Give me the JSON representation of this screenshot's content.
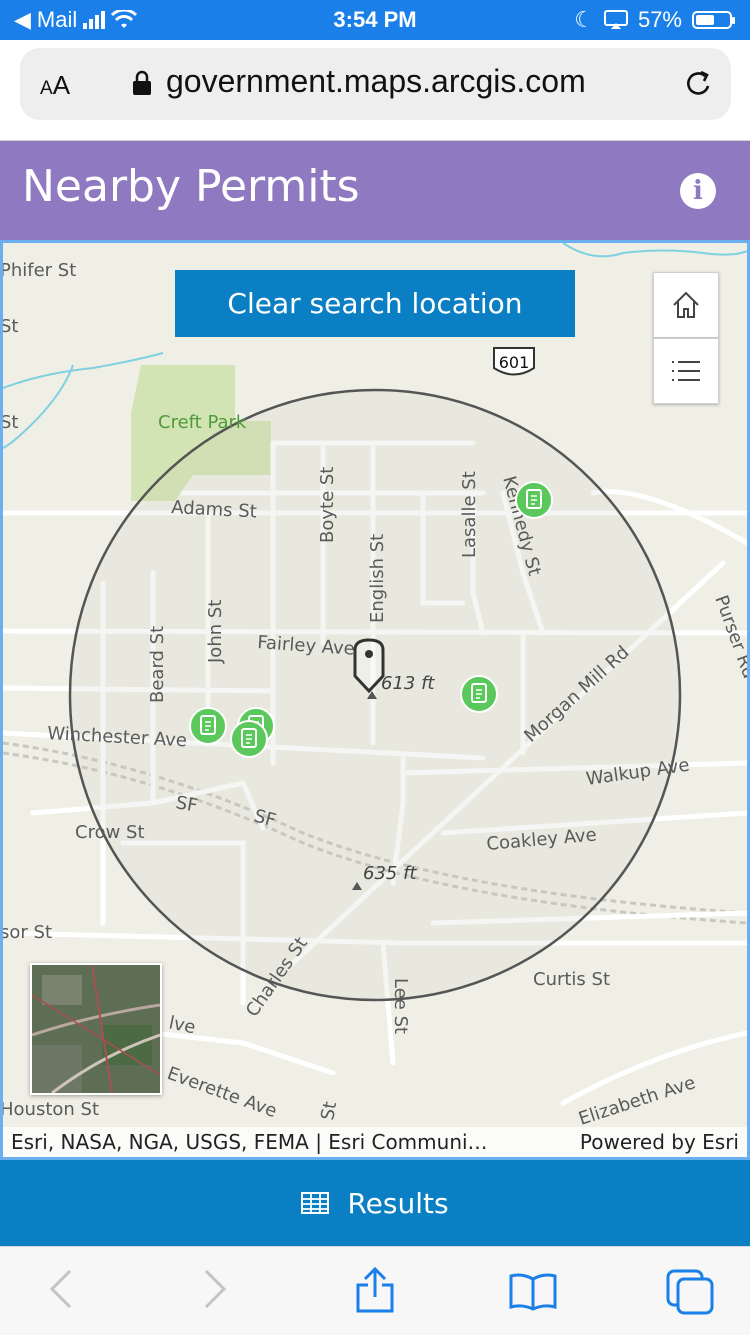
{
  "status": {
    "back_app": "Mail",
    "time": "3:54 PM",
    "battery": "57%",
    "battery_level": 0.57
  },
  "browser": {
    "text_size": "AA",
    "url": "government.maps.arcgis.com"
  },
  "app": {
    "title": "Nearby Permits"
  },
  "map": {
    "clear_button": "Clear search location",
    "highway_shield": "601",
    "park_label": "Creft Park",
    "elevations": [
      "613 ft",
      "635 ft"
    ],
    "streets": [
      "Phifer St",
      "St",
      "St",
      "Adams St",
      "Boyte St",
      "English St",
      "Lasalle St",
      "Kennedy St",
      "Fairley Ave",
      "Beard St",
      "John St",
      "Morgan Mill Rd",
      "Purser Rd",
      "Winchester Ave",
      "Walkup Ave",
      "SF",
      "SF",
      "Crow St",
      "Coakley Ave",
      "sor St",
      "Charles St",
      "Lee St",
      "Curtis St",
      "lve",
      "Everette Ave",
      "Houston St",
      "St",
      "Elizabeth Ave"
    ],
    "attribution": "Esri, NASA, NGA, USGS, FEMA | Esri Communi…",
    "powered_by": "Powered by Esri"
  },
  "results": {
    "label": "Results"
  },
  "icons": {
    "home": "home-icon",
    "layers": "layer-list-icon",
    "permit": "permit-icon",
    "table": "table-icon"
  },
  "colors": {
    "header": "#8f7ac1",
    "button": "#0a7fc4",
    "permit": "#5bc85b",
    "ios_blue": "#1a7fe8"
  }
}
